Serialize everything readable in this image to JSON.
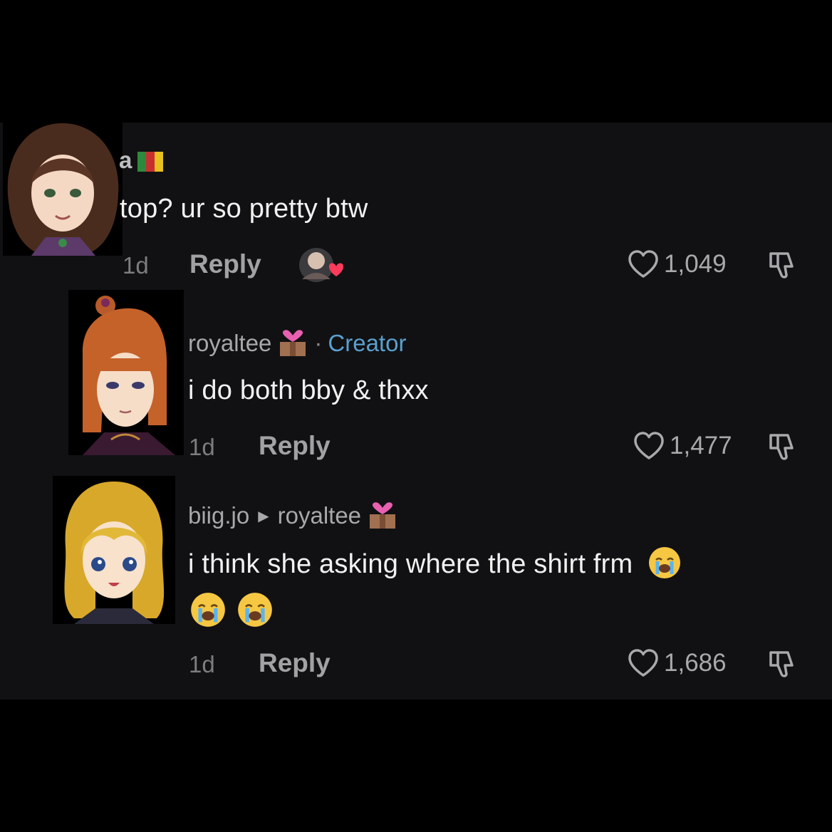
{
  "comments": [
    {
      "username": "a",
      "text": "top? ur so pretty btw",
      "age": "1d",
      "reply_label": "Reply",
      "likes": "1,049"
    },
    {
      "username": "royaltee",
      "badge_separator": "·",
      "badge": "Creator",
      "text": "i do both bby & thxx",
      "age": "1d",
      "reply_label": "Reply",
      "likes": "1,477"
    },
    {
      "username": "biig.jo",
      "replying_to": "royaltee",
      "text_line1": "i think she asking where the shirt frm",
      "age": "1d",
      "reply_label": "Reply",
      "likes": "1,686"
    }
  ],
  "icons": [
    "flag-icon",
    "gift-heart-icon",
    "creator-liked-avatar-icon",
    "heart-icon",
    "dislike-icon",
    "crying-emoji-icon",
    "reply-arrow-icon"
  ],
  "colors": {
    "background": "#000000",
    "panel": "#111113",
    "creator": "#5aa0cf",
    "muted": "#a2a2a5"
  }
}
